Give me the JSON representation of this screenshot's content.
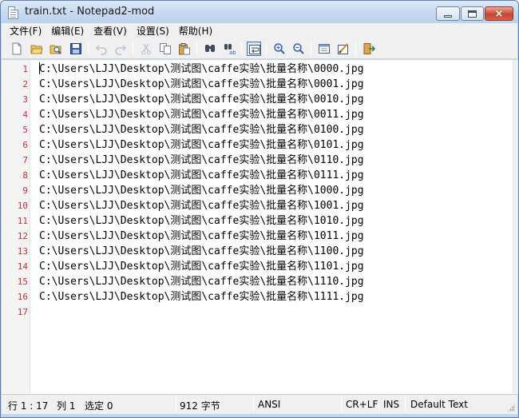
{
  "window": {
    "title": "train.txt - Notepad2-mod",
    "controls": {
      "minimize": "minimize",
      "maximize": "maximize",
      "close": "×"
    }
  },
  "menu": [
    "文件(F)",
    "编辑(E)",
    "查看(V)",
    "设置(S)",
    "帮助(H)"
  ],
  "toolbar": [
    {
      "name": "new-icon",
      "active": false
    },
    {
      "name": "open-folder-icon",
      "active": false
    },
    {
      "name": "browse-icon",
      "active": false
    },
    {
      "name": "save-icon",
      "active": false
    },
    {
      "name": "undo-icon",
      "active": false,
      "disabled": true
    },
    {
      "name": "redo-icon",
      "active": false,
      "disabled": true
    },
    {
      "name": "cut-icon",
      "active": false,
      "disabled": true
    },
    {
      "name": "copy-icon",
      "active": false
    },
    {
      "name": "paste-icon",
      "active": false
    },
    {
      "name": "find-icon",
      "active": false
    },
    {
      "name": "replace-icon",
      "active": false
    },
    {
      "name": "word-wrap-icon",
      "active": true
    },
    {
      "name": "zoom-in-icon",
      "active": false
    },
    {
      "name": "zoom-out-icon",
      "active": false
    },
    {
      "name": "scheme-icon",
      "active": false
    },
    {
      "name": "customize-scheme-icon",
      "active": false
    },
    {
      "name": "exit-icon",
      "active": false
    }
  ],
  "editor": {
    "line_numbers": [
      "1",
      "2",
      "3",
      "4",
      "5",
      "6",
      "7",
      "8",
      "9",
      "10",
      "11",
      "12",
      "13",
      "14",
      "15",
      "16",
      "17"
    ],
    "lines": [
      "C:\\Users\\LJJ\\Desktop\\测试图\\caffe实验\\批量名称\\0000.jpg",
      "C:\\Users\\LJJ\\Desktop\\测试图\\caffe实验\\批量名称\\0001.jpg",
      "C:\\Users\\LJJ\\Desktop\\测试图\\caffe实验\\批量名称\\0010.jpg",
      "C:\\Users\\LJJ\\Desktop\\测试图\\caffe实验\\批量名称\\0011.jpg",
      "C:\\Users\\LJJ\\Desktop\\测试图\\caffe实验\\批量名称\\0100.jpg",
      "C:\\Users\\LJJ\\Desktop\\测试图\\caffe实验\\批量名称\\0101.jpg",
      "C:\\Users\\LJJ\\Desktop\\测试图\\caffe实验\\批量名称\\0110.jpg",
      "C:\\Users\\LJJ\\Desktop\\测试图\\caffe实验\\批量名称\\0111.jpg",
      "C:\\Users\\LJJ\\Desktop\\测试图\\caffe实验\\批量名称\\1000.jpg",
      "C:\\Users\\LJJ\\Desktop\\测试图\\caffe实验\\批量名称\\1001.jpg",
      "C:\\Users\\LJJ\\Desktop\\测试图\\caffe实验\\批量名称\\1010.jpg",
      "C:\\Users\\LJJ\\Desktop\\测试图\\caffe实验\\批量名称\\1011.jpg",
      "C:\\Users\\LJJ\\Desktop\\测试图\\caffe实验\\批量名称\\1100.jpg",
      "C:\\Users\\LJJ\\Desktop\\测试图\\caffe实验\\批量名称\\1101.jpg",
      "C:\\Users\\LJJ\\Desktop\\测试图\\caffe实验\\批量名称\\1110.jpg",
      "C:\\Users\\LJJ\\Desktop\\测试图\\caffe实验\\批量名称\\1111.jpg",
      ""
    ]
  },
  "status": {
    "position": "行 1 : 17",
    "column": "列 1",
    "selection": "选定 0",
    "size": "912 字节",
    "encoding": "ANSI",
    "line_ending": "CR+LF",
    "insert_mode": "INS",
    "scheme": "Default Text"
  },
  "colors": {
    "line_number": "#d03030",
    "titlebar": "#c9dbf1",
    "close_button": "#c8452f"
  }
}
